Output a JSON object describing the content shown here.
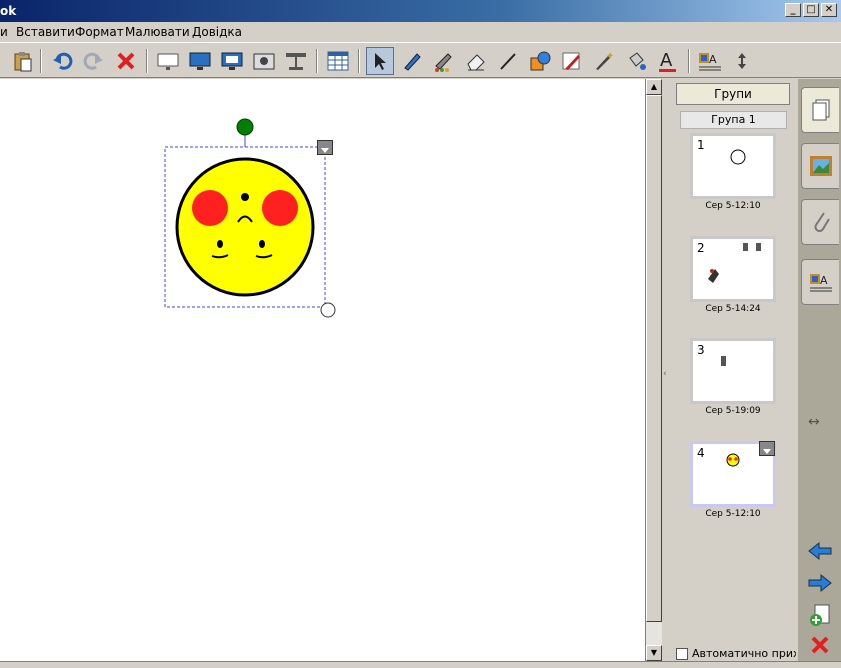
{
  "window": {
    "title": "ok",
    "minimize": "_",
    "maximize": "□",
    "close": "✕"
  },
  "menu": {
    "item0": "и",
    "insert": "Вставити",
    "format": "Формат",
    "draw": "Малювати",
    "help": "Довідка"
  },
  "toolbar": {
    "tools": [
      "paste-icon",
      "undo-icon",
      "redo-icon",
      "delete-icon",
      "screen-shade-icon",
      "full-screen-icon",
      "capture-icon",
      "camera-icon",
      "document-camera-icon",
      "table-icon",
      "select-icon",
      "pen-icon",
      "creative-pen-icon",
      "eraser-icon",
      "line-icon",
      "shapes-icon",
      "magic-pen-icon",
      "sparkle-pen-icon",
      "fill-icon",
      "text-icon",
      "properties-icon",
      "move-toolbar-icon"
    ]
  },
  "sorter": {
    "groups_button": "Групи",
    "group_label": "Група 1",
    "pages": [
      {
        "number": "1",
        "date": "Сер 5-12:10"
      },
      {
        "number": "2",
        "date": "Сер 5-14:24"
      },
      {
        "number": "3",
        "date": "Сер 5-19:09"
      },
      {
        "number": "4",
        "date": "Сер 5-12:10"
      }
    ],
    "auto_hide": "Автоматично прихо"
  },
  "colors": {
    "face": "#ffff00",
    "cheeks": "#ff2020",
    "rotate_handle": "#008000",
    "selection": "#4040ff",
    "title_start": "#0a246a"
  }
}
